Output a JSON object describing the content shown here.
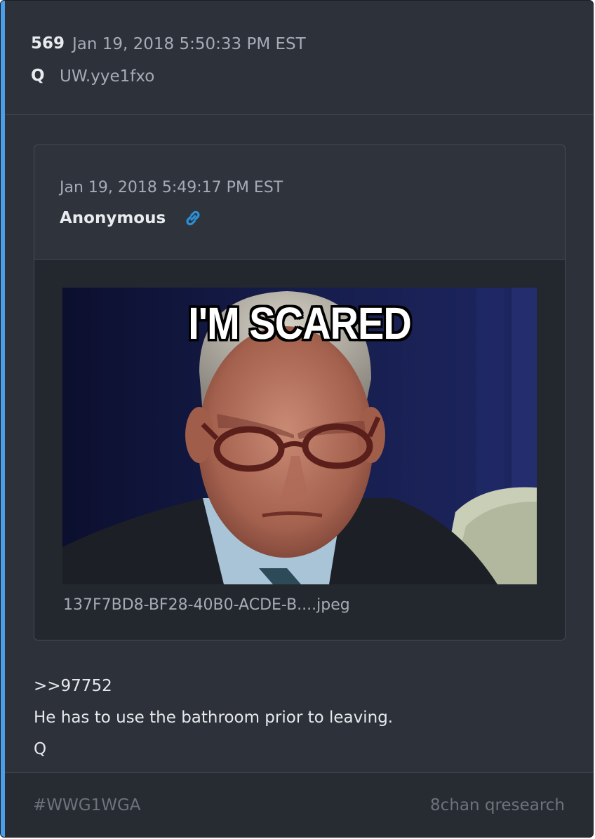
{
  "post": {
    "number": "569",
    "timestamp": "Jan 19, 2018 5:50:33 PM EST",
    "author_label": "Q",
    "tripcode": "UW.yye1fxo"
  },
  "quoted_post": {
    "timestamp": "Jan 19, 2018 5:49:17 PM EST",
    "author": "Anonymous",
    "link_icon": "link-icon",
    "image": {
      "caption_text": "I'M SCARED",
      "filename": "137F7BD8-BF28-40B0-ACDE-B....jpeg"
    }
  },
  "body": {
    "lines": [
      ">>97752",
      "He has to use the bathroom prior to leaving.",
      "Q"
    ]
  },
  "footer": {
    "hashtag": "#WWG1WGA",
    "source": "8chan qresearch"
  },
  "colors": {
    "accent": "#4d9ee8",
    "card_bg": "#2c313a",
    "link": "#2d8fd5"
  }
}
